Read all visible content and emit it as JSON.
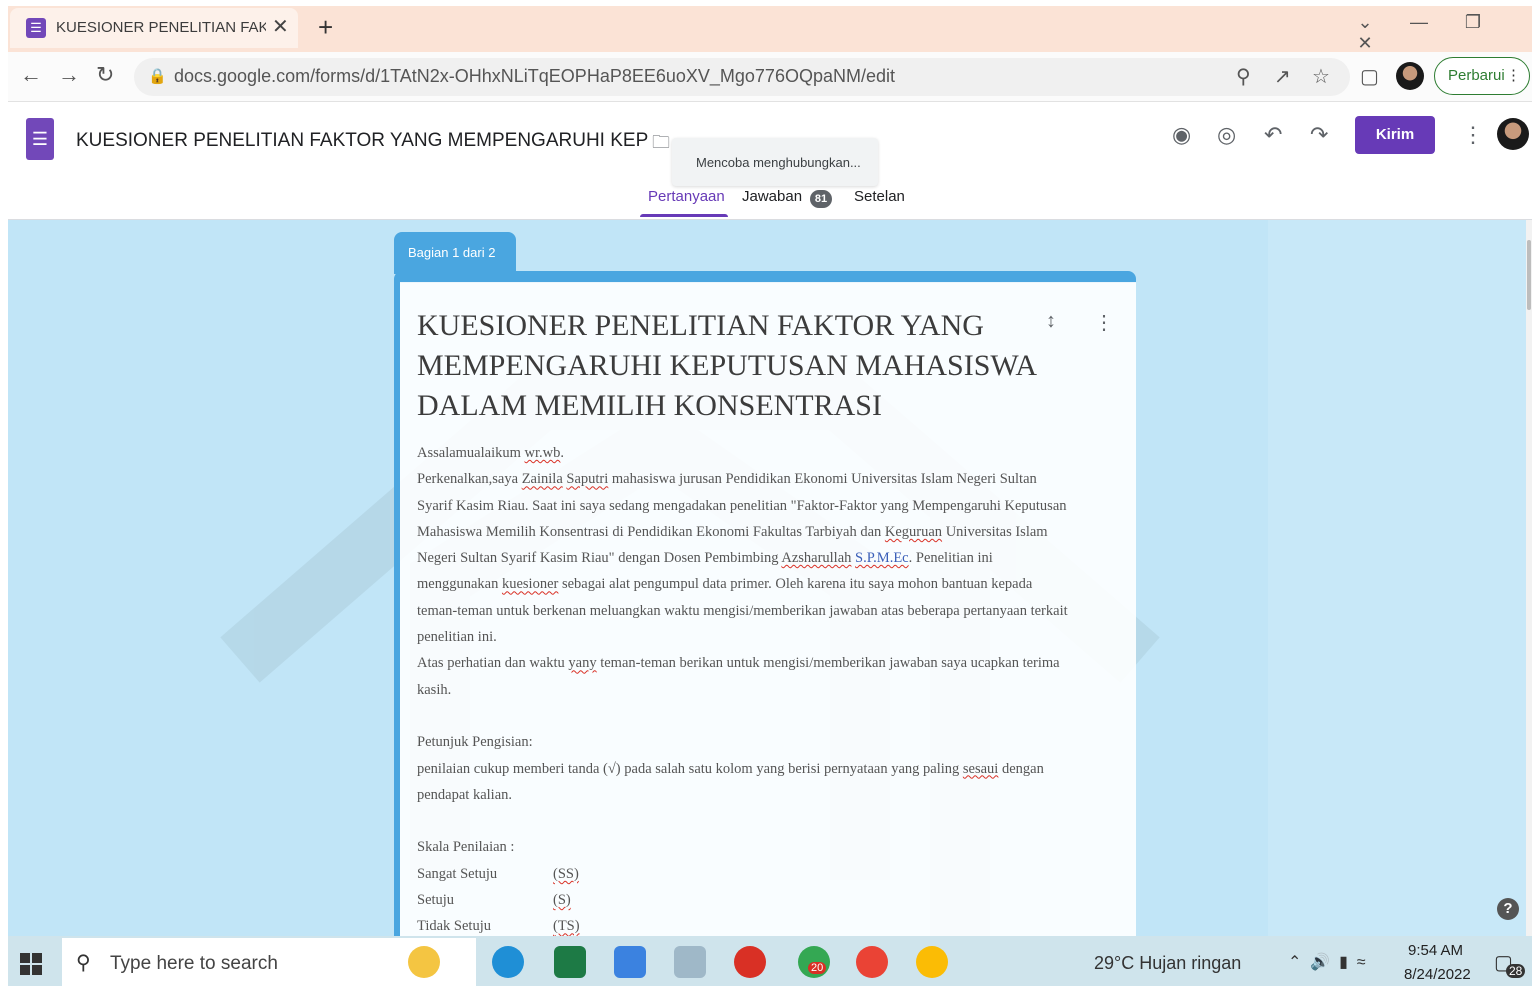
{
  "browser": {
    "tab_title": "KUESIONER PENELITIAN FAKTOR",
    "url": "docs.google.com/forms/d/1TAtN2x-OHhxNLiTqEOPHaP8EE6uoXV_Mgo776OQpaNM/edit",
    "update_label": "Perbarui"
  },
  "forms_header": {
    "doc_title": "KUESIONER PENELITIAN FAKTOR YANG MEMPENGARUHI KEPUTUSAN MAHASISWA",
    "toast": "Mencoba menghubungkan...",
    "send_label": "Kirim",
    "tabs": [
      {
        "label": "Pertanyaan"
      },
      {
        "label": "Jawaban",
        "badge": "81"
      },
      {
        "label": "Setelan"
      }
    ]
  },
  "section": {
    "label": "Bagian 1 dari 2"
  },
  "form": {
    "title": "KUESIONER PENELITIAN FAKTOR YANG MEMPENGARUHI KEPUTUSAN MAHASISWA DALAM MEMILIH KONSENTRASI",
    "greeting_a": "Assalamualaikum ",
    "greeting_b": "wr.wb",
    "greeting_c": ".",
    "l2a": "Perkenalkan,saya ",
    "l2b": "Zainila",
    "l2c": " ",
    "l2d": "Saputri",
    "l2e": " mahasiswa jurusan Pendidikan Ekonomi Universitas Islam Negeri Sultan",
    "l3": "Syarif Kasim Riau. Saat ini saya sedang mengadakan penelitian \"Faktor-Faktor yang Mempengaruhi Keputusan",
    "l4a": "Mahasiswa Memilih Konsentrasi di Pendidikan Ekonomi Fakultas Tarbiyah dan ",
    "l4b": "Keguruan",
    "l4c": " Universitas Islam",
    "l5a": "Negeri Sultan Syarif Kasim Riau\" dengan Dosen Pembimbing ",
    "l5b": "Azsharullah",
    "l5c": " ",
    "l5d": "S.P.M.Ec",
    "l5e": ". Penelitian ini",
    "l6a": "menggunakan ",
    "l6b": "kuesioner",
    "l6c": " sebagai alat pengumpul data primer. Oleh karena itu saya mohon bantuan kepada",
    "l7": "teman-teman untuk berkenan meluangkan waktu mengisi/memberikan jawaban atas beberapa pertanyaan terkait",
    "l8": "penelitian ini.",
    "l9a": "Atas perhatian dan waktu ",
    "l9b": "yany",
    "l9c": " teman-teman berikan untuk mengisi/memberikan jawaban saya ucapkan terima",
    "l10": "kasih.",
    "instr_title": "Petunjuk Pengisian:",
    "instr_1a": "penilaian cukup memberi tanda (√) pada salah satu kolom yang berisi pernyataan yang paling ",
    "instr_1b": "sesaui",
    "instr_1c": " dengan",
    "instr_2": "pendapat kalian.",
    "scale_title": "Skala Penilaian :",
    "scale": [
      {
        "label": "Sangat Setuju",
        "code": "(SS)"
      },
      {
        "label": "Setuju",
        "code": "(S)"
      },
      {
        "label": "Tidak Setuju",
        "code": "(TS)"
      }
    ]
  },
  "taskbar": {
    "search_placeholder": "Type here to search",
    "weather": "29°C  Hujan ringan",
    "time": "9:54 AM",
    "date": "8/24/2022",
    "notifications": "28",
    "chrome_badge": "20"
  },
  "colors": {
    "forms_purple": "#673ab7",
    "section_blue": "#4aa6e0",
    "page_bg": "#c1e5f7"
  }
}
